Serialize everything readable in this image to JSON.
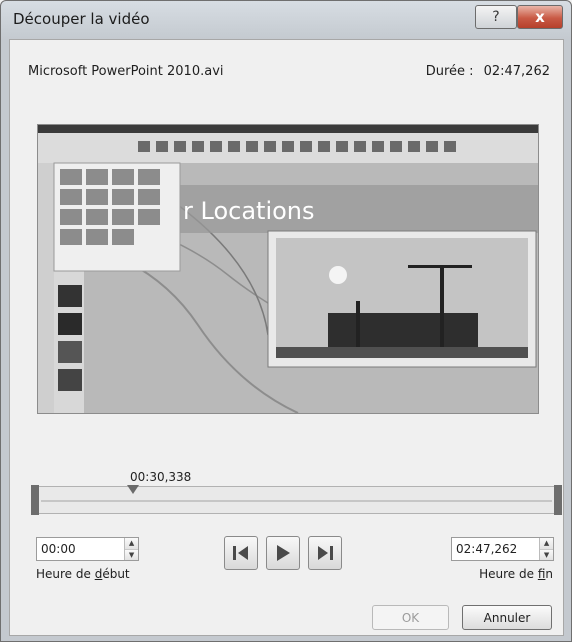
{
  "window": {
    "title": "Découper la vidéo"
  },
  "titlebar_buttons": {
    "help": "?",
    "close": "x"
  },
  "file": {
    "name": "Microsoft PowerPoint 2010.avi"
  },
  "duration": {
    "label": "Durée :",
    "value": "02:47,262"
  },
  "preview": {
    "slide_title": "r Locations"
  },
  "timeline": {
    "current_time": "00:30,338",
    "position_fraction": 0.18
  },
  "start": {
    "value": "00:00",
    "label_prefix": "Heure de ",
    "label_accel": "d",
    "label_rest": "ébut"
  },
  "end": {
    "value": "02:47,262",
    "label_prefix": "Heure de ",
    "label_accel": "f",
    "label_rest": "in"
  },
  "buttons": {
    "ok": "OK",
    "cancel": "Annuler"
  }
}
